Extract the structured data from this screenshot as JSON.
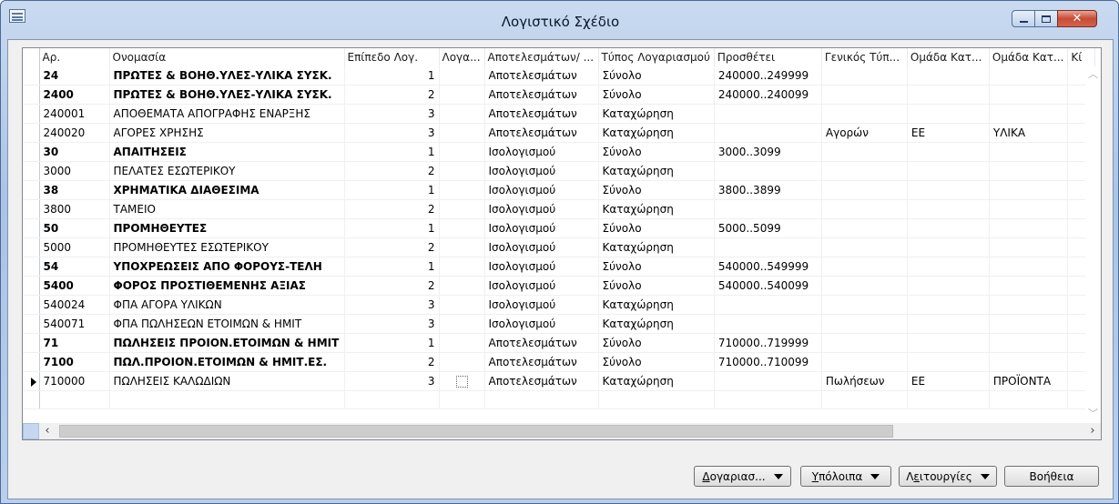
{
  "window": {
    "title": "Λογιστικό Σχέδιο",
    "close_glyph": "✕"
  },
  "table": {
    "columns": [
      "Αρ.",
      "Ονομασία",
      "Επίπεδο Λογ.",
      "Λογα...",
      "Αποτελεσμάτων/ ...",
      "Τύπος Λογαριασμού",
      "Προσθέτει",
      "Γενικός Τύπ...",
      "Ομάδα Κατ...",
      "Ομάδα Κατ...",
      "Κί"
    ],
    "rows": [
      {
        "no": "24",
        "name": "ΠΡΩΤΕΣ & ΒΟΗΘ.ΥΛΕΣ-ΥΛΙΚΑ ΣΥΣΚ.",
        "level": "1",
        "type": "Αποτελεσμάτων",
        "acct": "Σύνολο",
        "totaling": "240000..249999",
        "gen": "",
        "g1": "",
        "g2": "",
        "bold": true
      },
      {
        "no": "2400",
        "name": "ΠΡΩΤΕΣ & ΒΟΗΘ.ΥΛΕΣ-ΥΛΙΚΑ ΣΥΣΚ.",
        "level": "2",
        "type": "Αποτελεσμάτων",
        "acct": "Σύνολο",
        "totaling": "240000..240099",
        "gen": "",
        "g1": "",
        "g2": "",
        "bold": true
      },
      {
        "no": "240001",
        "name": "ΑΠΟΘΕΜΑΤΑ ΑΠΟΓΡΑΦΗΣ ΕΝΑΡΞΗΣ",
        "level": "3",
        "type": "Αποτελεσμάτων",
        "acct": "Καταχώρηση",
        "totaling": "",
        "gen": "",
        "g1": "",
        "g2": "",
        "bold": false
      },
      {
        "no": "240020",
        "name": "ΑΓΟΡΕΣ ΧΡΗΣΗΣ",
        "level": "3",
        "type": "Αποτελεσμάτων",
        "acct": "Καταχώρηση",
        "totaling": "",
        "gen": "Αγορών",
        "g1": "ΕΕ",
        "g2": "ΥΛΙΚΑ",
        "bold": false
      },
      {
        "no": "30",
        "name": "ΑΠΑΙΤΗΣΕΙΣ",
        "level": "1",
        "type": "Ισολογισμού",
        "acct": "Σύνολο",
        "totaling": "3000..3099",
        "gen": "",
        "g1": "",
        "g2": "",
        "bold": true
      },
      {
        "no": "3000",
        "name": "ΠΕΛΑΤΕΣ ΕΣΩΤΕΡΙΚΟΥ",
        "level": "2",
        "type": "Ισολογισμού",
        "acct": "Καταχώρηση",
        "totaling": "",
        "gen": "",
        "g1": "",
        "g2": "",
        "bold": false
      },
      {
        "no": "38",
        "name": "ΧΡΗΜΑΤΙΚΑ ΔΙΑΘΕΣΙΜΑ",
        "level": "1",
        "type": "Ισολογισμού",
        "acct": "Σύνολο",
        "totaling": "3800..3899",
        "gen": "",
        "g1": "",
        "g2": "",
        "bold": true
      },
      {
        "no": "3800",
        "name": "ΤΑΜΕΙΟ",
        "level": "2",
        "type": "Ισολογισμού",
        "acct": "Καταχώρηση",
        "totaling": "",
        "gen": "",
        "g1": "",
        "g2": "",
        "bold": false
      },
      {
        "no": "50",
        "name": "ΠΡΟΜΗΘΕΥΤΕΣ",
        "level": "1",
        "type": "Ισολογισμού",
        "acct": "Σύνολο",
        "totaling": "5000..5099",
        "gen": "",
        "g1": "",
        "g2": "",
        "bold": true
      },
      {
        "no": "5000",
        "name": "ΠΡΟΜΗΘΕΥΤΕΣ ΕΣΩΤΕΡΙΚΟΥ",
        "level": "2",
        "type": "Ισολογισμού",
        "acct": "Καταχώρηση",
        "totaling": "",
        "gen": "",
        "g1": "",
        "g2": "",
        "bold": false
      },
      {
        "no": "54",
        "name": "ΥΠΟΧΡΕΩΣΕΙΣ ΑΠΟ ΦΟΡΟΥΣ-ΤΕΛΗ",
        "level": "1",
        "type": "Ισολογισμού",
        "acct": "Σύνολο",
        "totaling": "540000..549999",
        "gen": "",
        "g1": "",
        "g2": "",
        "bold": true
      },
      {
        "no": "5400",
        "name": "ΦΟΡΟΣ ΠΡΟΣΤΙΘΕΜΕΝΗΣ ΑΞΙΑΣ",
        "level": "2",
        "type": "Ισολογισμού",
        "acct": "Σύνολο",
        "totaling": "540000..540099",
        "gen": "",
        "g1": "",
        "g2": "",
        "bold": true
      },
      {
        "no": "540024",
        "name": "ΦΠΑ ΑΓΟΡΑ ΥΛΙΚΩΝ",
        "level": "3",
        "type": "Ισολογισμού",
        "acct": "Καταχώρηση",
        "totaling": "",
        "gen": "",
        "g1": "",
        "g2": "",
        "bold": false
      },
      {
        "no": "540071",
        "name": "ΦΠΑ ΠΩΛΗΣΕΩΝ ΕΤΟΙΜΩΝ & ΗΜΙΤ",
        "level": "3",
        "type": "Ισολογισμού",
        "acct": "Καταχώρηση",
        "totaling": "",
        "gen": "",
        "g1": "",
        "g2": "",
        "bold": false
      },
      {
        "no": "71",
        "name": "ΠΩΛΗΣΕΙΣ ΠΡΟΙΟΝ.ΕΤΟΙΜΩΝ & ΗΜΙΤ",
        "level": "1",
        "type": "Αποτελεσμάτων",
        "acct": "Σύνολο",
        "totaling": "710000..719999",
        "gen": "",
        "g1": "",
        "g2": "",
        "bold": true
      },
      {
        "no": "7100",
        "name": "ΠΩΛ.ΠΡΟΙΟΝ.ΕΤΟΙΜΩΝ & ΗΜΙΤ.ΕΣ.",
        "level": "2",
        "type": "Αποτελεσμάτων",
        "acct": "Σύνολο",
        "totaling": "710000..710099",
        "gen": "",
        "g1": "",
        "g2": "",
        "bold": true
      },
      {
        "no": "710000",
        "name": "ΠΩΛΗΣΕΙΣ ΚΑΛΩΔΙΩΝ",
        "level": "3",
        "type": "Αποτελεσμάτων",
        "acct": "Καταχώρηση",
        "totaling": "",
        "gen": "Πωλήσεων",
        "g1": "ΕΕ",
        "g2": "ΠΡΟΪΟΝΤΑ",
        "bold": false,
        "current": true
      }
    ]
  },
  "buttons": {
    "accounts": {
      "underlined": "Δ",
      "rest": "ογαριασ..."
    },
    "balances": {
      "underlined": "Υ",
      "rest": "πόλοιπα"
    },
    "functions": {
      "prefix": "Λ",
      "underlined": "ε",
      "rest": "ιτουργίες"
    },
    "help": "Βοήθεια"
  }
}
